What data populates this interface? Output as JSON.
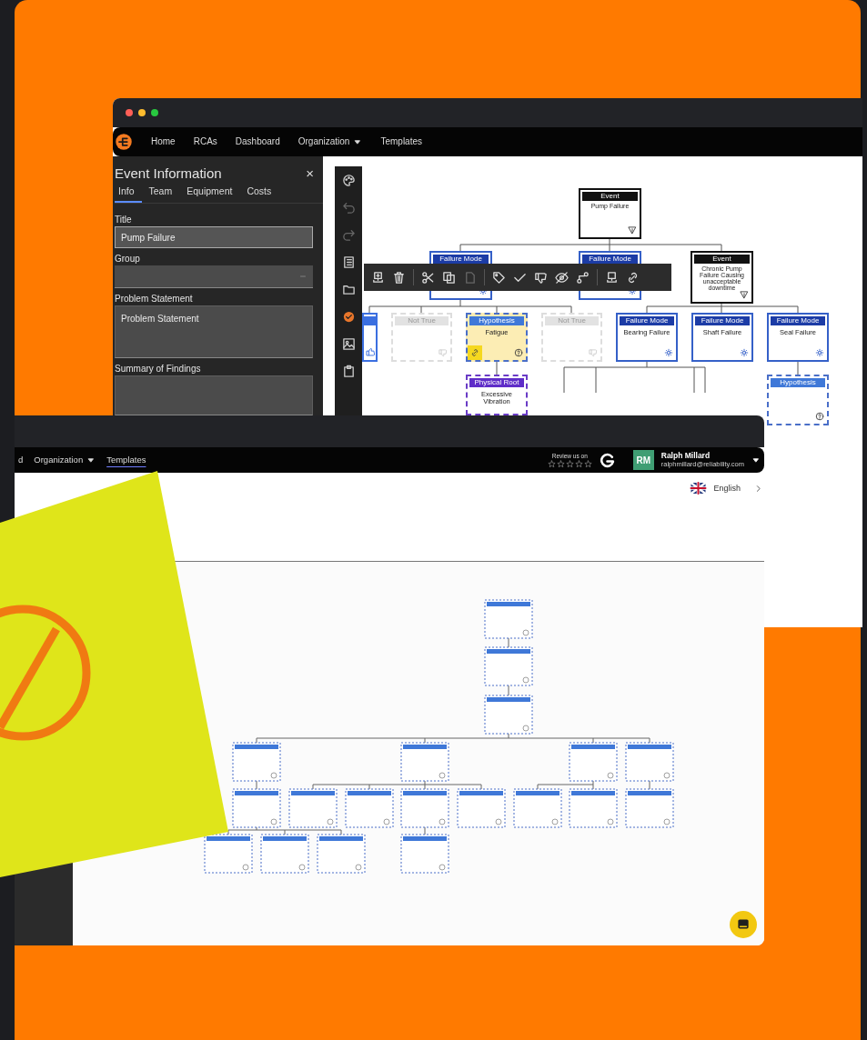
{
  "back_window": {
    "nav": {
      "items": [
        {
          "label": "Home",
          "kind": "link",
          "selected": false
        },
        {
          "label": "RCAs",
          "kind": "link",
          "selected": false
        },
        {
          "label": "Dashboard",
          "kind": "link",
          "selected": false
        },
        {
          "label": "Organization",
          "kind": "menu",
          "selected": false
        },
        {
          "label": "Templates",
          "kind": "link",
          "selected": false
        }
      ]
    },
    "panel": {
      "title": "Event Information",
      "close": "×",
      "tabs": [
        {
          "label": "Info",
          "selected": true
        },
        {
          "label": "Team",
          "selected": false
        },
        {
          "label": "Equipment",
          "selected": false
        },
        {
          "label": "Costs",
          "selected": false
        }
      ],
      "fields": [
        {
          "label": "Title",
          "kind": "input",
          "value": "Pump Failure"
        },
        {
          "label": "Group",
          "kind": "select"
        },
        {
          "label": "Problem Statement",
          "kind": "textarea",
          "placeholder": "Problem Statement"
        },
        {
          "label": "Summary of Findings",
          "kind": "textarea"
        }
      ]
    },
    "canvas": {
      "nodes": [
        {
          "kind": "event",
          "header": "Event",
          "text": "Pump Failure",
          "highlighted": false
        },
        {
          "kind": "failure_mode",
          "header": "Failure Mode",
          "highlighted": false
        },
        {
          "kind": "failure_mode",
          "header": "Failure Mode",
          "highlighted": false
        },
        {
          "kind": "event",
          "header": "Event",
          "text": "Chronic Pump Failure Causing unacceptable downtime",
          "highlighted": false
        },
        {
          "kind": "confirmed",
          "highlighted": false
        },
        {
          "kind": "not_true",
          "header": "Not True",
          "highlighted": false
        },
        {
          "kind": "hypothesis",
          "header": "Hypothesis",
          "text": "Fatigue",
          "highlighted": true
        },
        {
          "kind": "not_true",
          "header": "Not True",
          "highlighted": false
        },
        {
          "kind": "failure_mode",
          "header": "Failure Mode",
          "text": "Bearing Failure",
          "highlighted": false
        },
        {
          "kind": "failure_mode",
          "header": "Failure Mode",
          "text": "Shaft Failure",
          "highlighted": false
        },
        {
          "kind": "failure_mode",
          "header": "Failure Mode",
          "text": "Seal Failure",
          "highlighted": false
        },
        {
          "kind": "physical_root",
          "header": "Physical Root",
          "text": "Excessive Vibration",
          "highlighted": false
        },
        {
          "kind": "hypothesis",
          "header": "Hypothesis",
          "highlighted": false
        }
      ]
    }
  },
  "front_window": {
    "nav": {
      "items": [
        {
          "label": "d",
          "kind": "link",
          "selected": false
        },
        {
          "label": "Organization",
          "kind": "menu",
          "selected": false
        },
        {
          "label": "Templates",
          "kind": "link",
          "selected": true
        }
      ]
    },
    "review": {
      "label": "Review us on",
      "stars": 0
    },
    "user": {
      "initials": "RM",
      "name": "Ralph Millard",
      "email": "ralphmillard@reliability.com"
    },
    "language": "English"
  }
}
